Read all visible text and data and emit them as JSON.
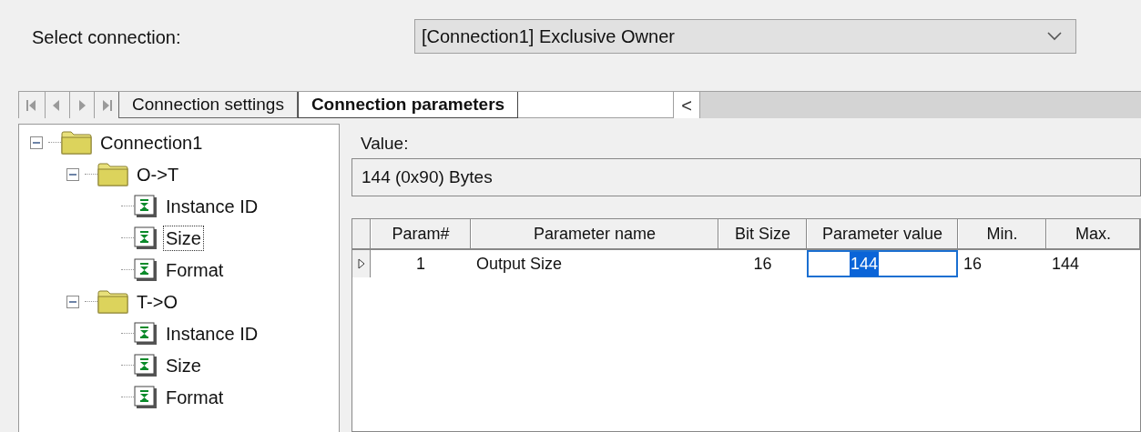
{
  "connection_select": {
    "label": "Select connection:",
    "value": "[Connection1] Exclusive Owner"
  },
  "tabs": [
    {
      "label": "Connection settings",
      "selected": false
    },
    {
      "label": "Connection parameters",
      "selected": true
    }
  ],
  "tab_scroll": "<",
  "tree": [
    {
      "label": "Connection1",
      "kind": "folder",
      "expanded": true,
      "selected": false,
      "children": [
        {
          "label": "O->T",
          "kind": "folder",
          "expanded": true,
          "selected": false,
          "children": [
            {
              "label": "Instance ID",
              "kind": "parameter",
              "selected": false
            },
            {
              "label": "Size",
              "kind": "parameter",
              "selected": true
            },
            {
              "label": "Format",
              "kind": "parameter",
              "selected": false
            }
          ]
        },
        {
          "label": "T->O",
          "kind": "folder",
          "expanded": true,
          "selected": false,
          "children": [
            {
              "label": "Instance ID",
              "kind": "parameter",
              "selected": false
            },
            {
              "label": "Size",
              "kind": "parameter",
              "selected": false
            },
            {
              "label": "Format",
              "kind": "parameter",
              "selected": false
            }
          ]
        }
      ]
    }
  ],
  "value": {
    "label": "Value:",
    "text": "144 (0x90) Bytes"
  },
  "table": {
    "columns": [
      "Param#",
      "Parameter name",
      "Bit Size",
      "Parameter value",
      "Min.",
      "Max."
    ],
    "rows": [
      {
        "current": true,
        "cells": [
          {
            "text": "1",
            "editing": false
          },
          {
            "text": "Output Size",
            "editing": false
          },
          {
            "text": "16",
            "editing": false
          },
          {
            "text": "144",
            "editing": true
          },
          {
            "text": "16",
            "editing": false
          },
          {
            "text": "144",
            "editing": false
          }
        ]
      }
    ]
  }
}
